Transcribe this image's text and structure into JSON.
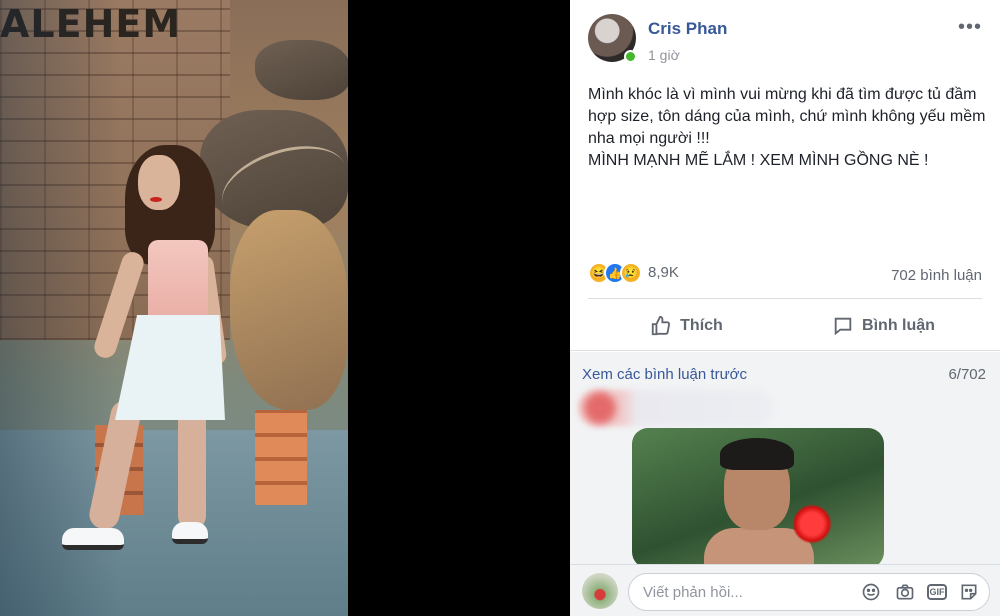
{
  "photo": {
    "wall_sign": "ALEHEM"
  },
  "post": {
    "author": "Cris Phan",
    "timestamp": "1 giờ",
    "more_label": "•••",
    "text_lines": [
      "Mình khóc là vì mình vui mừng khi đã tìm được tủ đầm hợp size, tôn dáng của mình, chứ mình không yếu mềm nha mọi người !!!",
      "MÌNH MẠNH MẼ LẮM ! XEM MÌNH GỒNG NÈ !"
    ]
  },
  "reactions": {
    "icons": [
      "haha-reaction-icon",
      "like-reaction-icon",
      "sad-reaction-icon"
    ],
    "count": "8,9K",
    "comments": "702 bình luận"
  },
  "actions": {
    "like": "Thích",
    "comment": "Bình luận"
  },
  "comments": {
    "view_previous": "Xem các bình luận trước",
    "pager": "6/702"
  },
  "reply": {
    "placeholder": "Viết phản hồi...",
    "gif_label": "GIF"
  },
  "colors": {
    "link": "#385898",
    "muted": "#606770",
    "online": "#42b72a",
    "panel_bg": "#f2f3f5"
  }
}
